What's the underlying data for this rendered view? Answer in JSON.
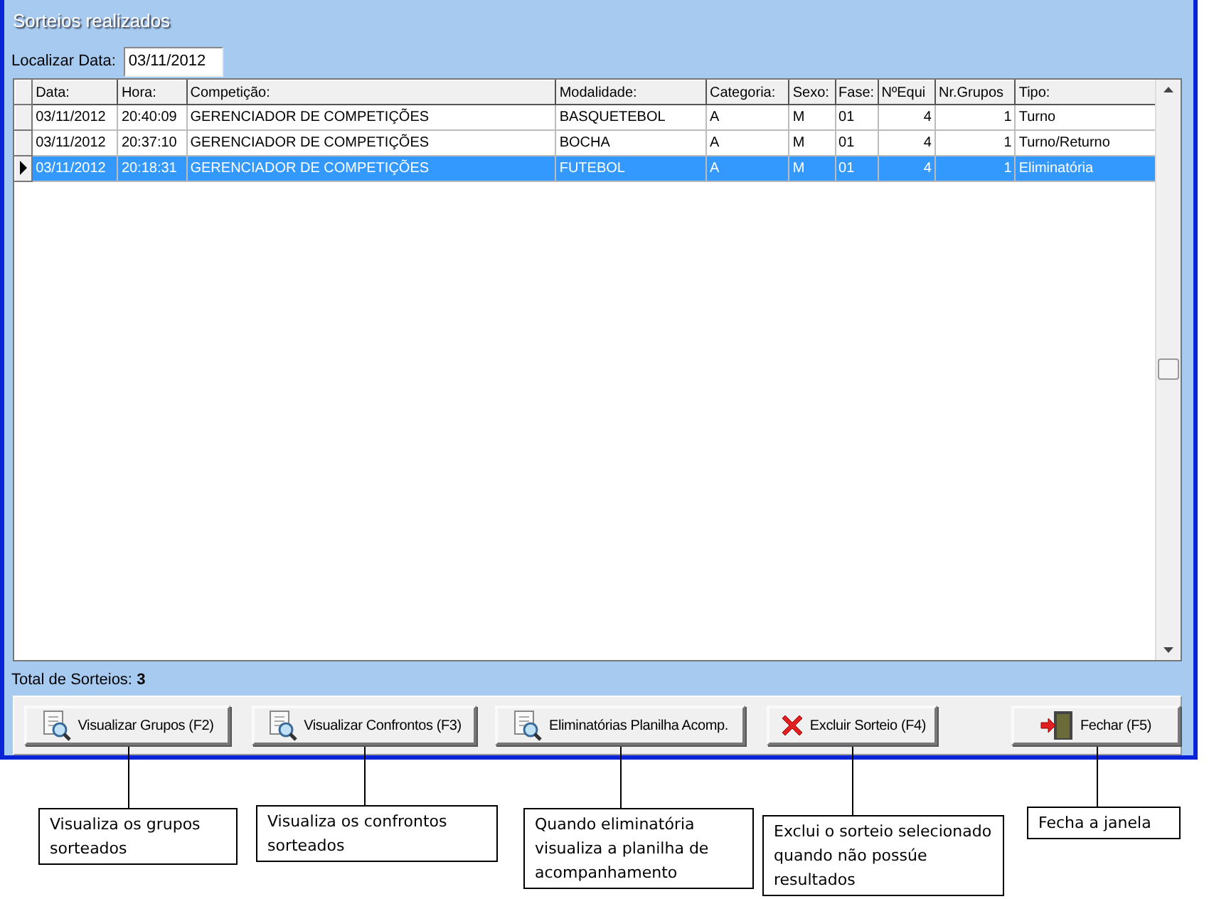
{
  "window": {
    "title": "Sorteios realizados"
  },
  "filter": {
    "label": "Localizar Data:",
    "value": "03/11/2012"
  },
  "table": {
    "columns": [
      "Data:",
      "Hora:",
      "Competição:",
      "Modalidade:",
      "Categoria:",
      "Sexo:",
      "Fase:",
      "NºEqui",
      "Nr.Grupos",
      "Tipo:"
    ],
    "rows": [
      {
        "cells": [
          "03/11/2012",
          "20:40:09",
          "GERENCIADOR DE COMPETIÇÕES",
          "BASQUETEBOL",
          "A",
          "M",
          "01",
          "4",
          "1",
          "Turno"
        ],
        "selected": false
      },
      {
        "cells": [
          "03/11/2012",
          "20:37:10",
          "GERENCIADOR DE COMPETIÇÕES",
          "BOCHA",
          "A",
          "M",
          "01",
          "4",
          "1",
          "Turno/Returno"
        ],
        "selected": false
      },
      {
        "cells": [
          "03/11/2012",
          "20:18:31",
          "GERENCIADOR DE COMPETIÇÕES",
          "FUTEBOL",
          "A",
          "M",
          "01",
          "4",
          "1",
          "Eliminatória"
        ],
        "selected": true
      }
    ]
  },
  "total": "Total de Sorteios: **3**",
  "buttons": [
    {
      "label": "Visualizar Grupos (F2)",
      "kind": "view"
    },
    {
      "label": "Visualizar Confrontos (F3)",
      "kind": "view"
    },
    {
      "label": "Eliminatórias Planilha Acomp.",
      "kind": "view"
    },
    {
      "label": "Excluir Sorteio (F4)",
      "kind": "delete"
    },
    {
      "label": "Fechar (F5)",
      "kind": "exit"
    }
  ],
  "annotations": [
    {
      "text": "Visualiza os grupos sorteados"
    },
    {
      "text": "Visualiza os confrontos sorteados"
    },
    {
      "text": "Quando eliminatória visualiza a planilha de acompanhamento"
    },
    {
      "text": "Exclui o sorteio selecionado quando não possúe resultados"
    },
    {
      "text": "Fecha a janela"
    }
  ]
}
